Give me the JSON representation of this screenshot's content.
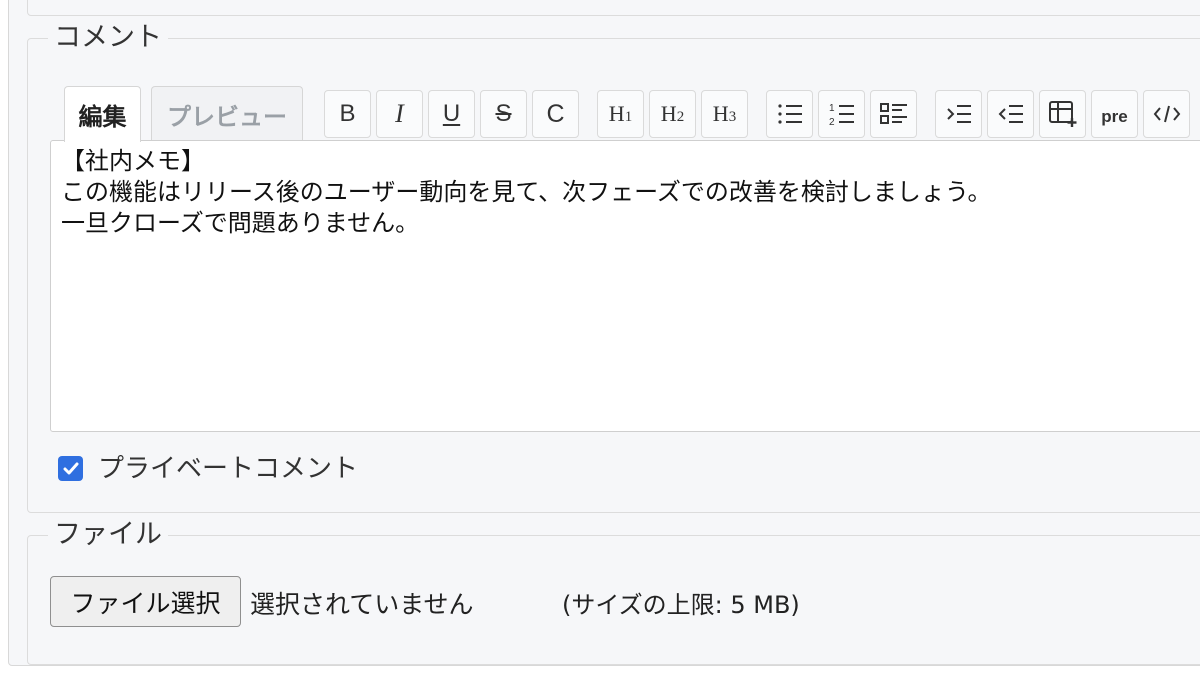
{
  "comment_section": {
    "legend": "コメント",
    "tabs": {
      "edit": "編集",
      "preview": "プレビュー"
    },
    "toolbar": {
      "bold": "B",
      "italic": "I",
      "underline": "U",
      "strike": "S",
      "code_inline": "C",
      "h1": "H1",
      "h2": "H2",
      "h3": "H3",
      "pre": "pre"
    },
    "textarea_value": "【社内メモ】\nこの機能はリリース後のユーザー動向を見て、次フェーズでの改善を検討しましょう。\n一旦クローズで問題ありません。",
    "private_checkbox": {
      "label": "プライベートコメント",
      "checked": true
    }
  },
  "file_section": {
    "legend": "ファイル",
    "choose_button": "ファイル選択",
    "status": "選択されていません",
    "size_limit": "(サイズの上限: 5 MB)"
  },
  "colors": {
    "accent": "#2f6fe0",
    "panel_bg": "#f6f7f9"
  }
}
